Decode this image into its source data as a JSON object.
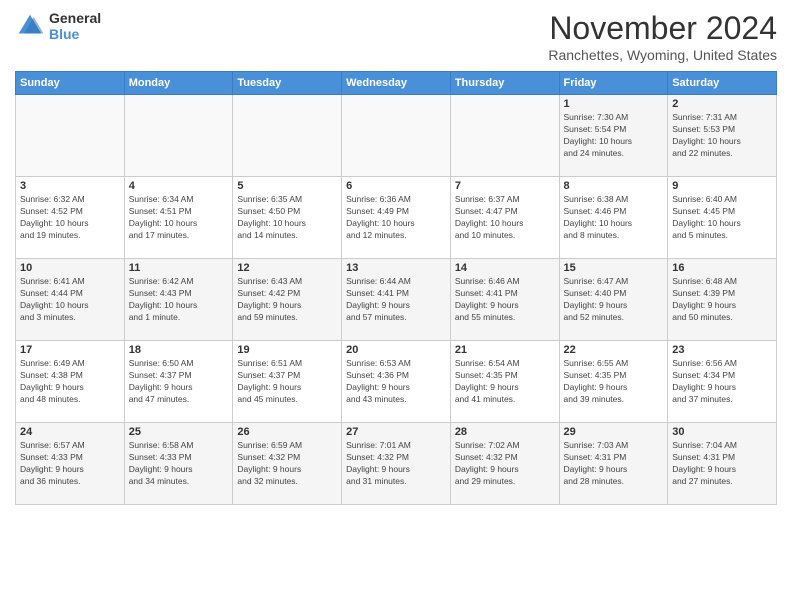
{
  "header": {
    "logo_general": "General",
    "logo_blue": "Blue",
    "month_title": "November 2024",
    "location": "Ranchettes, Wyoming, United States"
  },
  "days_of_week": [
    "Sunday",
    "Monday",
    "Tuesday",
    "Wednesday",
    "Thursday",
    "Friday",
    "Saturday"
  ],
  "weeks": [
    [
      {
        "day": "",
        "info": ""
      },
      {
        "day": "",
        "info": ""
      },
      {
        "day": "",
        "info": ""
      },
      {
        "day": "",
        "info": ""
      },
      {
        "day": "",
        "info": ""
      },
      {
        "day": "1",
        "info": "Sunrise: 7:30 AM\nSunset: 5:54 PM\nDaylight: 10 hours\nand 24 minutes."
      },
      {
        "day": "2",
        "info": "Sunrise: 7:31 AM\nSunset: 5:53 PM\nDaylight: 10 hours\nand 22 minutes."
      }
    ],
    [
      {
        "day": "3",
        "info": "Sunrise: 6:32 AM\nSunset: 4:52 PM\nDaylight: 10 hours\nand 19 minutes."
      },
      {
        "day": "4",
        "info": "Sunrise: 6:34 AM\nSunset: 4:51 PM\nDaylight: 10 hours\nand 17 minutes."
      },
      {
        "day": "5",
        "info": "Sunrise: 6:35 AM\nSunset: 4:50 PM\nDaylight: 10 hours\nand 14 minutes."
      },
      {
        "day": "6",
        "info": "Sunrise: 6:36 AM\nSunset: 4:49 PM\nDaylight: 10 hours\nand 12 minutes."
      },
      {
        "day": "7",
        "info": "Sunrise: 6:37 AM\nSunset: 4:47 PM\nDaylight: 10 hours\nand 10 minutes."
      },
      {
        "day": "8",
        "info": "Sunrise: 6:38 AM\nSunset: 4:46 PM\nDaylight: 10 hours\nand 8 minutes."
      },
      {
        "day": "9",
        "info": "Sunrise: 6:40 AM\nSunset: 4:45 PM\nDaylight: 10 hours\nand 5 minutes."
      }
    ],
    [
      {
        "day": "10",
        "info": "Sunrise: 6:41 AM\nSunset: 4:44 PM\nDaylight: 10 hours\nand 3 minutes."
      },
      {
        "day": "11",
        "info": "Sunrise: 6:42 AM\nSunset: 4:43 PM\nDaylight: 10 hours\nand 1 minute."
      },
      {
        "day": "12",
        "info": "Sunrise: 6:43 AM\nSunset: 4:42 PM\nDaylight: 9 hours\nand 59 minutes."
      },
      {
        "day": "13",
        "info": "Sunrise: 6:44 AM\nSunset: 4:41 PM\nDaylight: 9 hours\nand 57 minutes."
      },
      {
        "day": "14",
        "info": "Sunrise: 6:46 AM\nSunset: 4:41 PM\nDaylight: 9 hours\nand 55 minutes."
      },
      {
        "day": "15",
        "info": "Sunrise: 6:47 AM\nSunset: 4:40 PM\nDaylight: 9 hours\nand 52 minutes."
      },
      {
        "day": "16",
        "info": "Sunrise: 6:48 AM\nSunset: 4:39 PM\nDaylight: 9 hours\nand 50 minutes."
      }
    ],
    [
      {
        "day": "17",
        "info": "Sunrise: 6:49 AM\nSunset: 4:38 PM\nDaylight: 9 hours\nand 48 minutes."
      },
      {
        "day": "18",
        "info": "Sunrise: 6:50 AM\nSunset: 4:37 PM\nDaylight: 9 hours\nand 47 minutes."
      },
      {
        "day": "19",
        "info": "Sunrise: 6:51 AM\nSunset: 4:37 PM\nDaylight: 9 hours\nand 45 minutes."
      },
      {
        "day": "20",
        "info": "Sunrise: 6:53 AM\nSunset: 4:36 PM\nDaylight: 9 hours\nand 43 minutes."
      },
      {
        "day": "21",
        "info": "Sunrise: 6:54 AM\nSunset: 4:35 PM\nDaylight: 9 hours\nand 41 minutes."
      },
      {
        "day": "22",
        "info": "Sunrise: 6:55 AM\nSunset: 4:35 PM\nDaylight: 9 hours\nand 39 minutes."
      },
      {
        "day": "23",
        "info": "Sunrise: 6:56 AM\nSunset: 4:34 PM\nDaylight: 9 hours\nand 37 minutes."
      }
    ],
    [
      {
        "day": "24",
        "info": "Sunrise: 6:57 AM\nSunset: 4:33 PM\nDaylight: 9 hours\nand 36 minutes."
      },
      {
        "day": "25",
        "info": "Sunrise: 6:58 AM\nSunset: 4:33 PM\nDaylight: 9 hours\nand 34 minutes."
      },
      {
        "day": "26",
        "info": "Sunrise: 6:59 AM\nSunset: 4:32 PM\nDaylight: 9 hours\nand 32 minutes."
      },
      {
        "day": "27",
        "info": "Sunrise: 7:01 AM\nSunset: 4:32 PM\nDaylight: 9 hours\nand 31 minutes."
      },
      {
        "day": "28",
        "info": "Sunrise: 7:02 AM\nSunset: 4:32 PM\nDaylight: 9 hours\nand 29 minutes."
      },
      {
        "day": "29",
        "info": "Sunrise: 7:03 AM\nSunset: 4:31 PM\nDaylight: 9 hours\nand 28 minutes."
      },
      {
        "day": "30",
        "info": "Sunrise: 7:04 AM\nSunset: 4:31 PM\nDaylight: 9 hours\nand 27 minutes."
      }
    ]
  ]
}
